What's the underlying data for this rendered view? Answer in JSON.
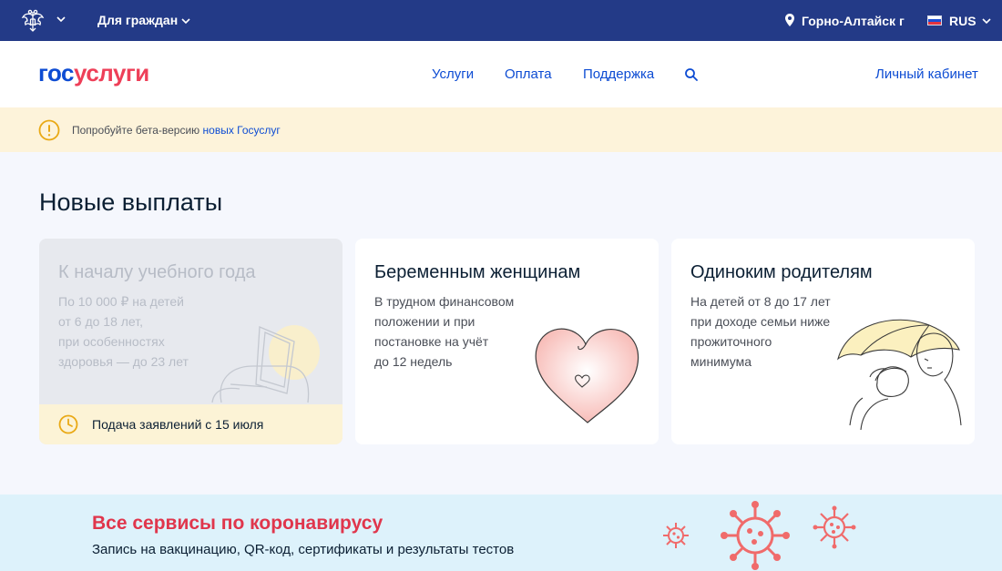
{
  "topbar": {
    "emblem_icon": "coat-of-arms-icon",
    "audience": "Для граждан",
    "location": "Горно-Алтайск г",
    "language": "RUS"
  },
  "header": {
    "logo": {
      "part1": "гос",
      "part2": "услуги"
    },
    "nav": [
      "Услуги",
      "Оплата",
      "Поддержка"
    ],
    "search_icon": "search-icon",
    "account": "Личный кабинет"
  },
  "notice": {
    "text": "Попробуйте бета-версию",
    "link": "новых Госуслуг"
  },
  "main": {
    "heading": "Новые выплаты",
    "cards": [
      {
        "title": "К началу учебного года",
        "description": "По 10 000 ₽ на детей\nот 6 до 18 лет,\nпри особенностях\nздоровья — до 23 лет",
        "footer": "Подача заявлений с 15 июля",
        "illustration": "backpack-illustration"
      },
      {
        "title": "Беременным женщинам",
        "description": "В трудном финансовом\nположении и при\nпостановке на учёт\nдо 12 недель",
        "illustration": "heart-illustration"
      },
      {
        "title": "Одиноким родителям",
        "description": "На детей от 8 до 17 лет\nпри доходе семьи ниже\nпрожиточного\nминимума",
        "illustration": "umbrella-illustration"
      }
    ]
  },
  "covid": {
    "title": "Все сервисы по коронавирусу",
    "subtitle": "Запись на вакцинацию, QR-код, сертификаты и результаты тестов"
  },
  "colors": {
    "topbar": "#233a87",
    "brand_blue": "#0d4cd3",
    "brand_red": "#ee3f58",
    "notice_bg": "#fdf3da",
    "page_bg": "#f5f7fd",
    "covid_bg": "#ddf2fb",
    "virus": "#f06b6b"
  }
}
